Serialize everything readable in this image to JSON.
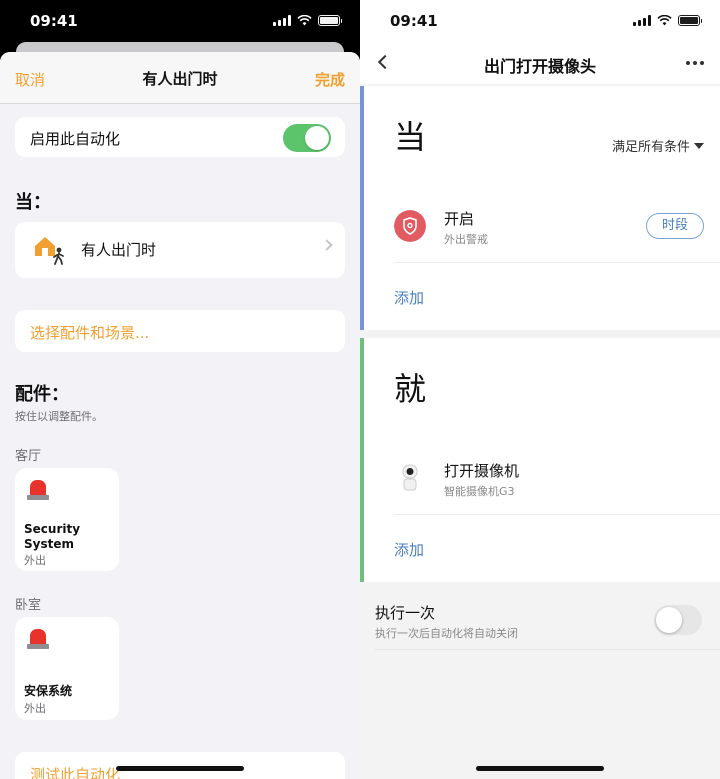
{
  "left": {
    "status_time": "09:41",
    "nav": {
      "cancel": "取消",
      "title": "有人出门时",
      "done": "完成"
    },
    "enable": {
      "label": "启用此自动化",
      "on": true
    },
    "when_heading": "当：",
    "trigger_label": "有人出门时",
    "choose_label": "选择配件和场景...",
    "accessories_heading": "配件：",
    "accessories_hint": "按住以调整配件。",
    "rooms": [
      {
        "name": "客厅",
        "tile": {
          "name_line1": "Security",
          "name_line2": "System",
          "state": "外出"
        }
      },
      {
        "name": "卧室",
        "tile": {
          "name_line1": "安保系统",
          "state": "外出"
        }
      }
    ],
    "test_label": "测试此自动化",
    "colors": {
      "accent": "#f0a030",
      "toggle_on": "#5cc46a"
    }
  },
  "right": {
    "status_time": "09:41",
    "title": "出门打开摄像头",
    "when": {
      "heading": "当",
      "condition_mode": "满足所有条件",
      "item": {
        "title": "开启",
        "subtitle": "外出警戒",
        "pill": "时段"
      },
      "add": "添加"
    },
    "then": {
      "heading": "就",
      "item": {
        "title": "打开摄像机",
        "subtitle": "智能摄像机G3"
      },
      "add": "添加"
    },
    "once": {
      "title": "执行一次",
      "subtitle": "执行一次后自动化将自动关闭",
      "on": false
    },
    "colors": {
      "when_stripe": "#7b92d4",
      "then_stripe": "#6dbf80",
      "link": "#4a7fc0"
    }
  }
}
